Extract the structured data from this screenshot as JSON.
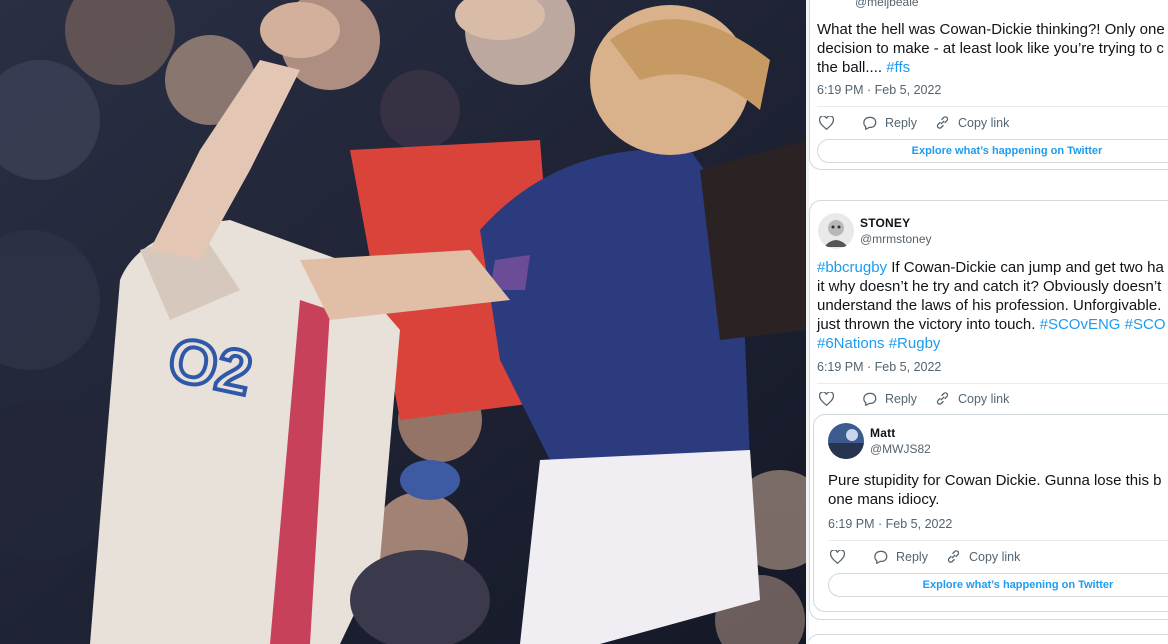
{
  "tweets": [
    {
      "handle": "@meljbeale",
      "text_lines": [
        [
          {
            "t": "What the hell was Cowan-Dickie thinking?! Only one",
            "tag": false
          }
        ],
        [
          {
            "t": "decision to make - at least look like you’re trying to c",
            "tag": false
          }
        ],
        [
          {
            "t": "the ball.... ",
            "tag": false
          },
          {
            "t": "#ffs",
            "tag": true
          }
        ]
      ],
      "time": "6:19 PM · Feb 5, 2022",
      "actions": {
        "reply": "Reply",
        "copy": "Copy link"
      },
      "explore": "Explore what’s happening on Twitter"
    },
    {
      "name": "STONEY",
      "handle": "@mrmstoney",
      "text_lines": [
        [
          {
            "t": "#bbcrugby",
            "tag": true
          },
          {
            "t": " If Cowan-Dickie can jump and get two ha",
            "tag": false
          }
        ],
        [
          {
            "t": "it why doesn’t he try and catch it? Obviously doesn’t",
            "tag": false
          }
        ],
        [
          {
            "t": "understand the laws of his profession. Unforgivable.",
            "tag": false
          }
        ],
        [
          {
            "t": "just thrown the victory into touch. ",
            "tag": false
          },
          {
            "t": "#SCOvENG",
            "tag": true
          },
          {
            "t": " ",
            "tag": false
          },
          {
            "t": "#SCO",
            "tag": true
          }
        ],
        [
          {
            "t": "#6Nations",
            "tag": true
          },
          {
            "t": " ",
            "tag": false
          },
          {
            "t": "#Rugby",
            "tag": true
          }
        ]
      ],
      "time": "6:19 PM · Feb 5, 2022",
      "actions": {
        "reply": "Reply",
        "copy": "Copy link"
      }
    },
    {
      "name": "Matt",
      "handle": "@MWJS82",
      "text_lines": [
        [
          {
            "t": "Pure stupidity for Cowan Dickie. Gunna lose this b",
            "tag": false
          }
        ],
        [
          {
            "t": "one mans idiocy.",
            "tag": false
          }
        ]
      ],
      "time": "6:19 PM · Feb 5, 2022",
      "actions": {
        "reply": "Reply",
        "copy": "Copy link"
      },
      "explore": "Explore what’s happening on Twitter"
    }
  ],
  "icons": [
    "heart-icon",
    "reply-icon",
    "link-icon"
  ],
  "colors": {
    "accent": "#1d9bf0",
    "text": "#0f1419",
    "muted": "#536471",
    "border": "#cfd9de"
  },
  "photo": {
    "jersey_logo": "O2"
  }
}
